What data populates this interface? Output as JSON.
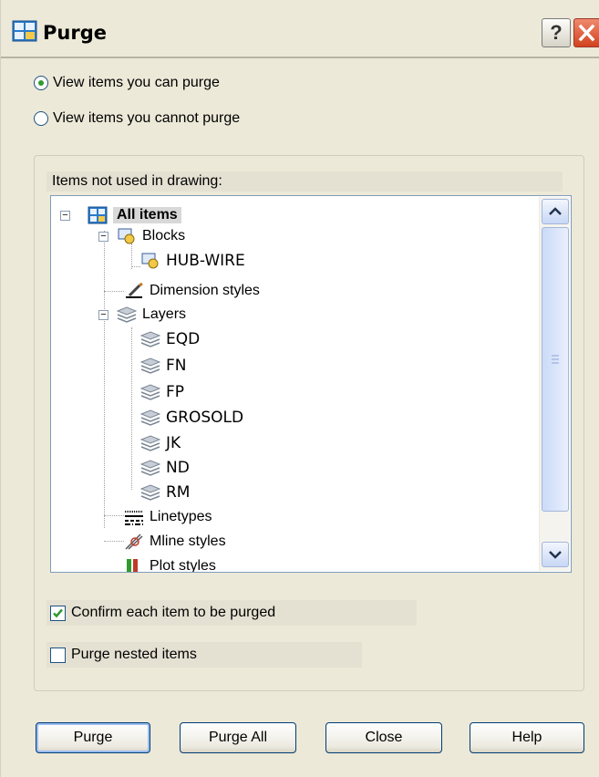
{
  "window": {
    "title": "Purge",
    "help_label": "?"
  },
  "view_options": {
    "can_purge_label": "View items you can purge",
    "cannot_purge_label": "View items you cannot purge",
    "selected": "can_purge"
  },
  "tree": {
    "header": "Items not used in drawing:",
    "items": [
      {
        "label": "All items",
        "icon": "purge-icon"
      },
      {
        "label": "Blocks",
        "icon": "block-icon"
      },
      {
        "label": "HUB-WIRE",
        "icon": "block-icon"
      },
      {
        "label": "Dimension styles",
        "icon": "dimension-icon"
      },
      {
        "label": "Layers",
        "icon": "layers-icon"
      },
      {
        "label": "EQD",
        "icon": "layers-icon"
      },
      {
        "label": "FN",
        "icon": "layers-icon"
      },
      {
        "label": "FP",
        "icon": "layers-icon"
      },
      {
        "label": "GROSOLD",
        "icon": "layers-icon"
      },
      {
        "label": "JK",
        "icon": "layers-icon"
      },
      {
        "label": "ND",
        "icon": "layers-icon"
      },
      {
        "label": "RM",
        "icon": "layers-icon"
      },
      {
        "label": "Linetypes",
        "icon": "linetype-icon"
      },
      {
        "label": "Mline styles",
        "icon": "mline-icon"
      },
      {
        "label": "Plot styles",
        "icon": "plotstyle-icon"
      }
    ]
  },
  "options": {
    "confirm_label": "Confirm each item to be purged",
    "confirm_checked": true,
    "nested_label": "Purge nested items",
    "nested_checked": false
  },
  "buttons": {
    "purge": "Purge",
    "purge_all": "Purge All",
    "close": "Close",
    "help": "Help"
  },
  "colors": {
    "window_bg": "#ece9d8",
    "tree_border": "#7f9db9",
    "check_green": "#2f9a2f",
    "close_red": "#d2421e"
  }
}
